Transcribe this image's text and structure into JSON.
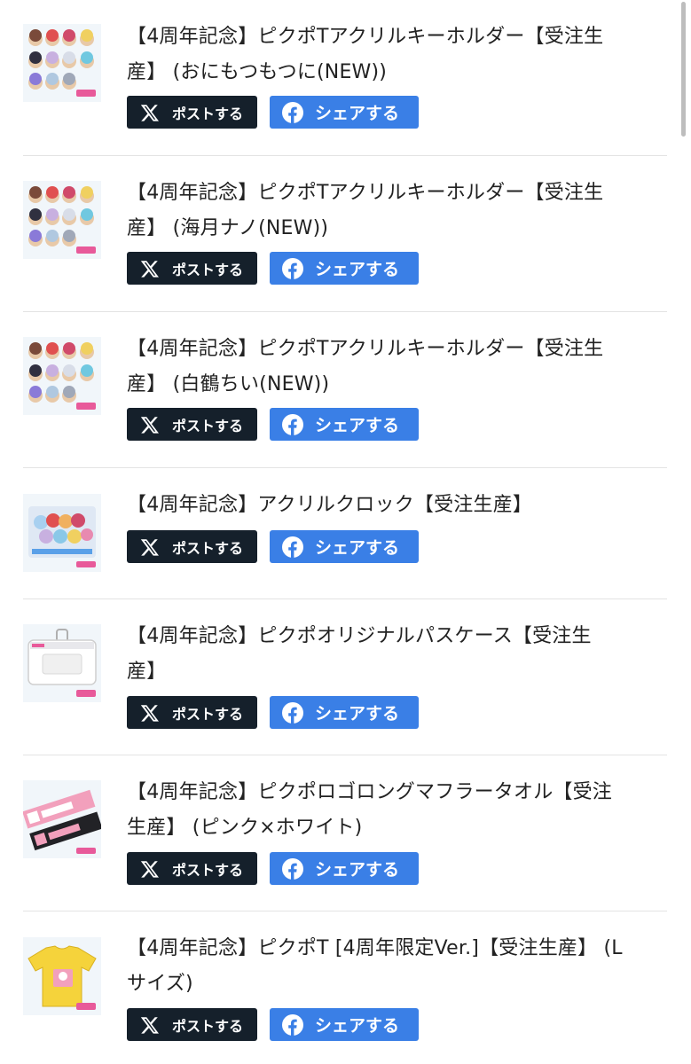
{
  "share_buttons": {
    "post_label": "ポストする",
    "share_label": "シェアする"
  },
  "items": [
    {
      "title_line1": "【4周年記念】ピクポTアクリルキーホルダー【受注生",
      "title_line2": "産】 (おにもつもつに(NEW))",
      "thumb": "acrylic-keychain-group"
    },
    {
      "title_line1": "【4周年記念】ピクポTアクリルキーホルダー【受注生",
      "title_line2": "産】 (海月ナノ(NEW))",
      "thumb": "acrylic-keychain-group"
    },
    {
      "title_line1": "【4周年記念】ピクポTアクリルキーホルダー【受注生",
      "title_line2": "産】 (白鶴ちい(NEW))",
      "thumb": "acrylic-keychain-group"
    },
    {
      "title_line1": "【4周年記念】アクリルクロック【受注生産】",
      "title_line2": "",
      "thumb": "acrylic-clock"
    },
    {
      "title_line1": "【4周年記念】ピクポオリジナルパスケース【受注生",
      "title_line2": "産】",
      "thumb": "pass-case"
    },
    {
      "title_line1": "【4周年記念】ピクポロゴロングマフラータオル【受注",
      "title_line2": "生産】 (ピンク×ホワイト)",
      "thumb": "muffler-towel"
    },
    {
      "title_line1": "【4周年記念】ピクポT [4周年限定Ver.]【受注生産】 (L",
      "title_line2": "サイズ)",
      "thumb": "t-shirt"
    }
  ]
}
